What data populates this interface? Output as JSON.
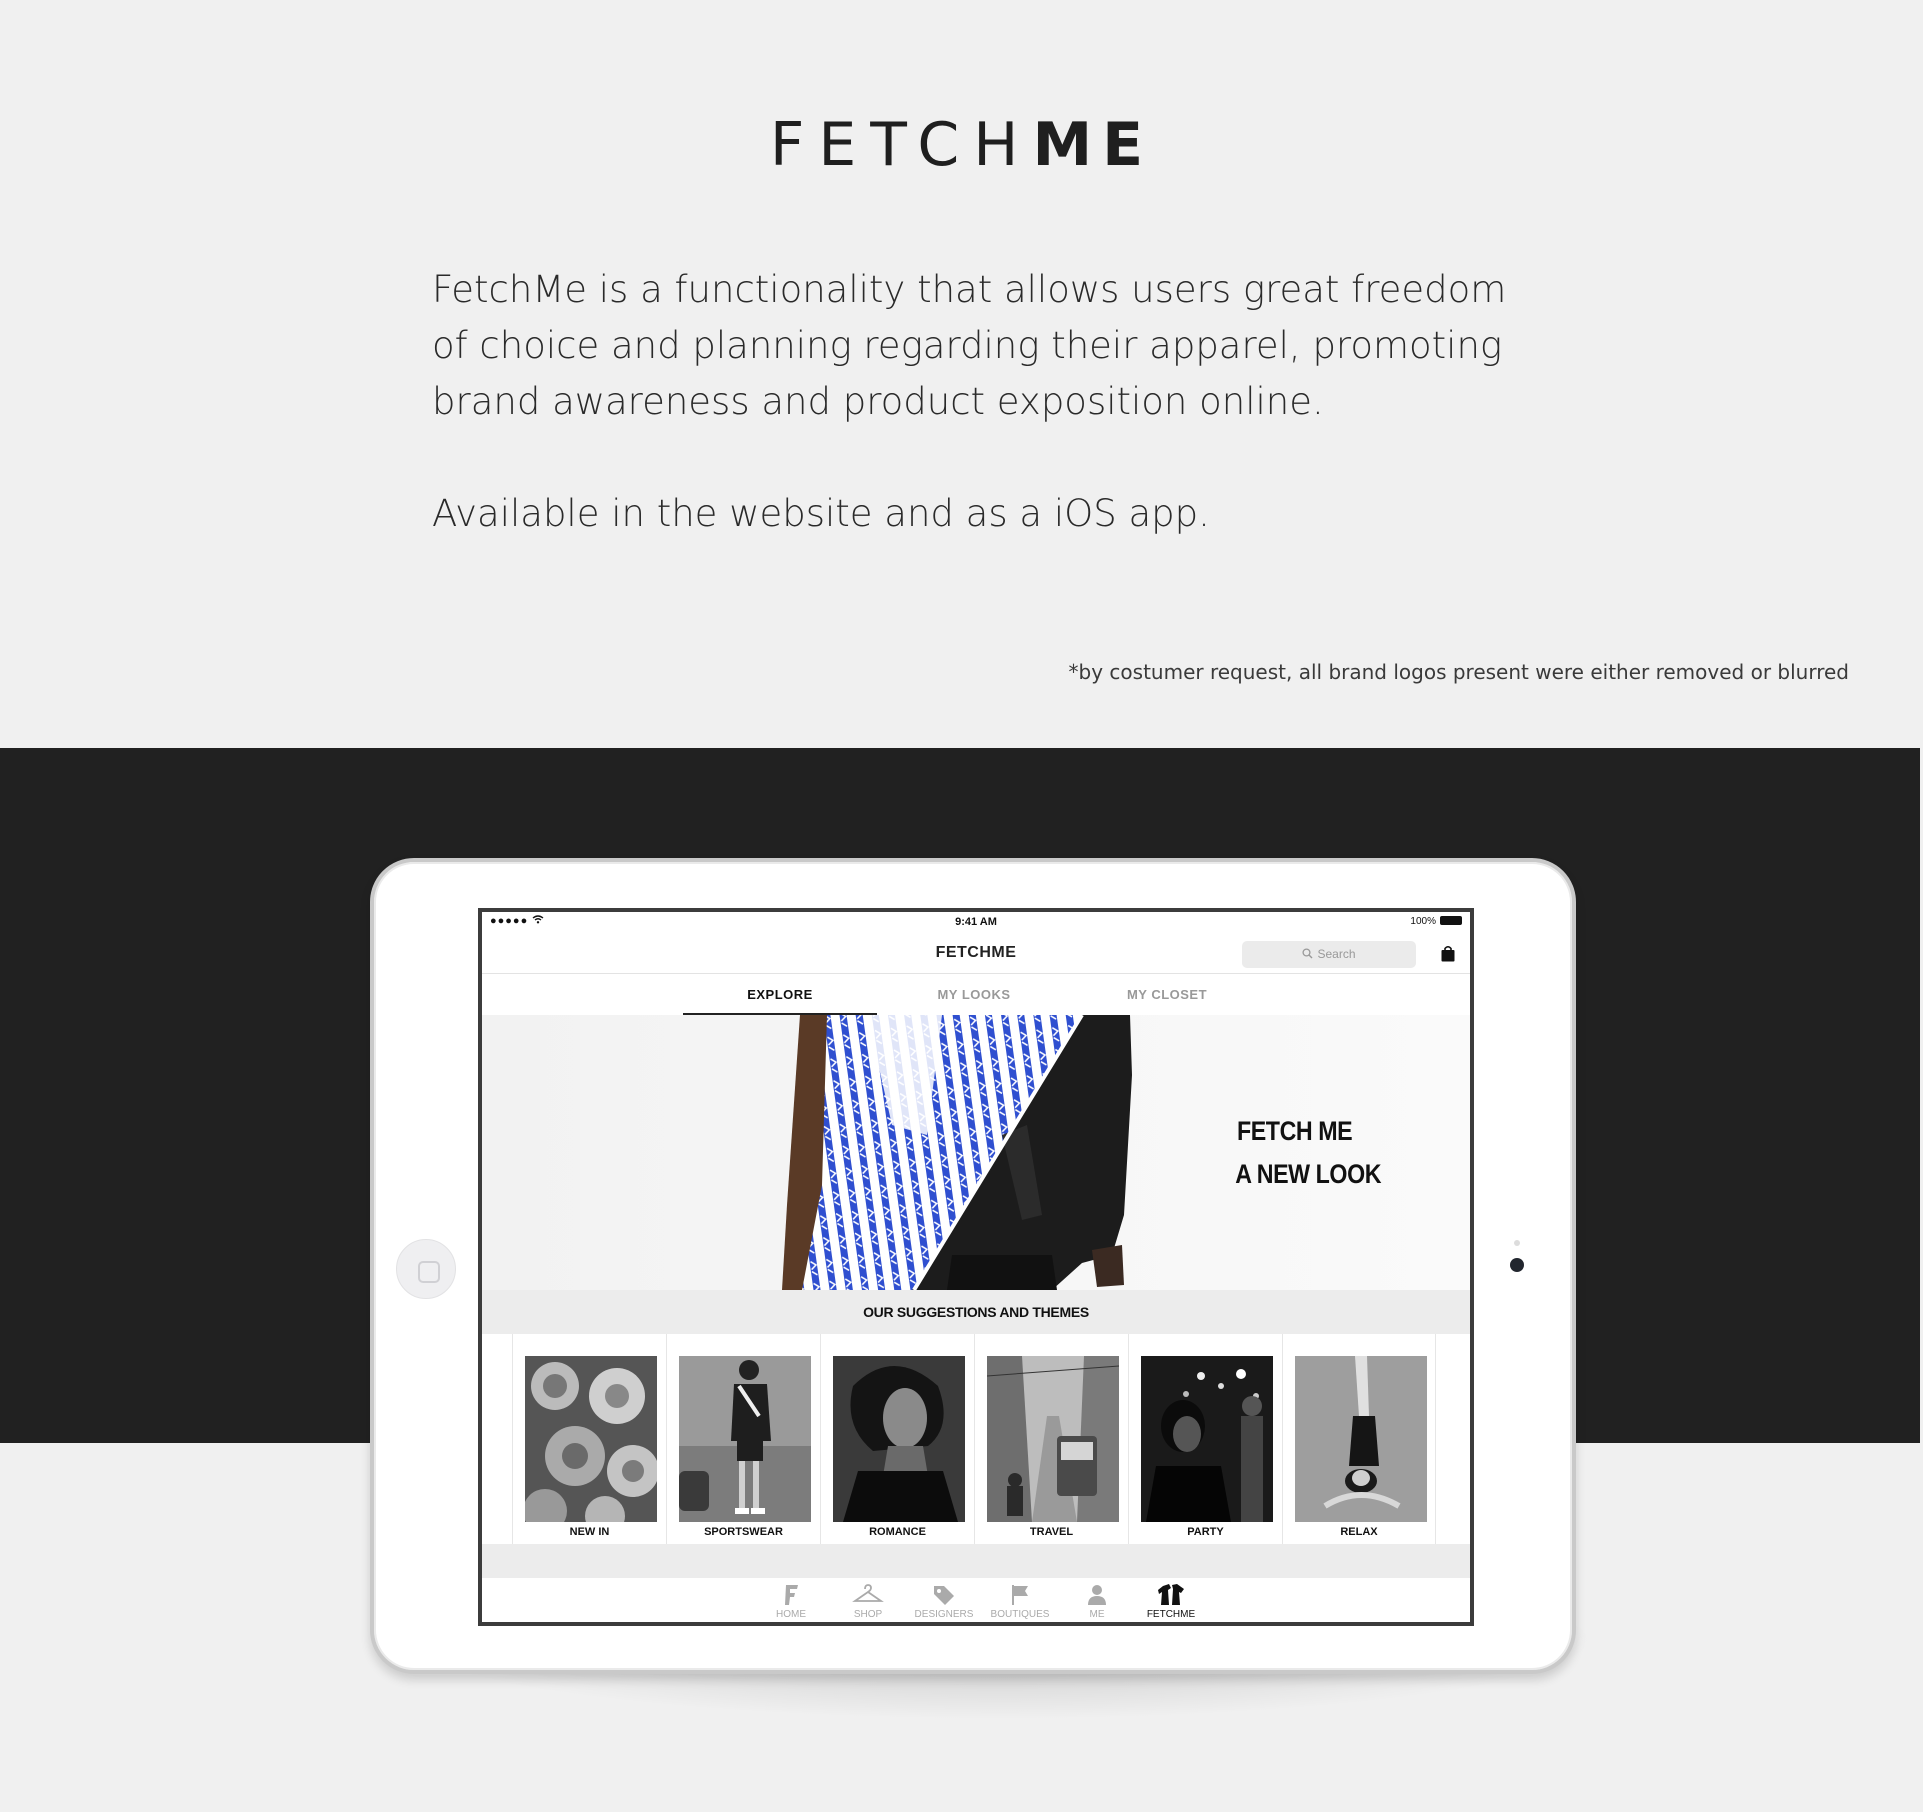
{
  "page": {
    "logo_light": "FETCH",
    "logo_bold": "ME",
    "intro_paragraph_1": "FetchMe is a functionality that allows users great freedom of choice and planning regarding their apparel, promoting brand awareness and product exposition online.",
    "intro_paragraph_2": "Available in the website and as a iOS app.",
    "disclaimer": "*by costumer request, all brand logos present were either removed or blurred"
  },
  "app": {
    "status": {
      "signal": "●●●●● ",
      "time": "9:41 AM",
      "battery": "100%"
    },
    "nav": {
      "title": "FETCHME",
      "search_placeholder": "Search"
    },
    "tabs": [
      {
        "label": "EXPLORE",
        "active": true
      },
      {
        "label": "MY LOOKS",
        "active": false
      },
      {
        "label": "MY CLOSET",
        "active": false
      }
    ],
    "hero": {
      "line1": "FETCH ME",
      "line2": "A NEW LOOK"
    },
    "section_title": "OUR SUGGESTIONS AND THEMES",
    "themes": [
      {
        "label": "NEW IN"
      },
      {
        "label": "SPORTSWEAR"
      },
      {
        "label": "ROMANCE"
      },
      {
        "label": "TRAVEL"
      },
      {
        "label": "PARTY"
      },
      {
        "label": "RELAX"
      }
    ],
    "tabbar": [
      {
        "label": "HOME",
        "icon": "home-f-icon"
      },
      {
        "label": "SHOP",
        "icon": "hanger-icon"
      },
      {
        "label": "DESIGNERS",
        "icon": "tag-icon"
      },
      {
        "label": "BOUTIQUES",
        "icon": "flag-icon"
      },
      {
        "label": "ME",
        "icon": "person-icon"
      },
      {
        "label": "FETCHME",
        "icon": "fetchme-icon",
        "active": true
      }
    ]
  },
  "colors": {
    "dark_band": "#212121",
    "page_bg": "#f0f0f0",
    "accent_blue": "#2f4fd0"
  }
}
